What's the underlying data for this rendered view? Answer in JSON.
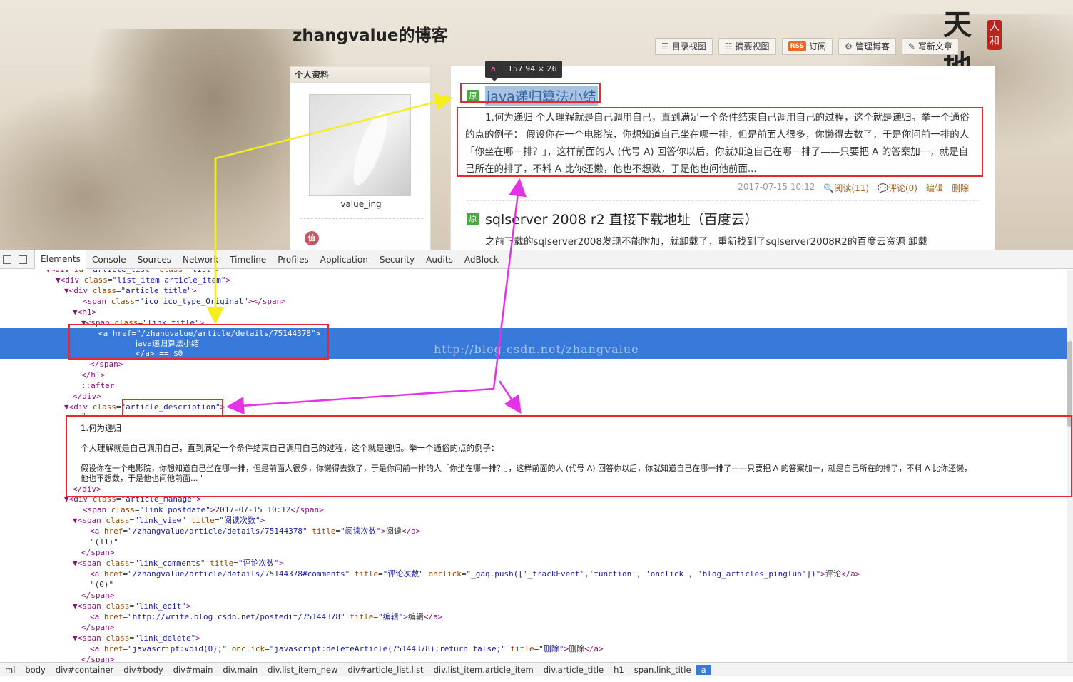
{
  "blog": {
    "title": "zhangvalue的博客",
    "seal_text": "人和",
    "calligraphy": "天地",
    "toolbar": [
      {
        "icon": "list-icon",
        "glyph": "☰",
        "label": "目录视图"
      },
      {
        "icon": "summary-icon",
        "glyph": "☷",
        "label": "摘要视图"
      },
      {
        "icon": "rss-icon",
        "glyph": "RSS",
        "label": "订阅"
      },
      {
        "icon": "gear-icon",
        "glyph": "⚙",
        "label": "管理博客"
      },
      {
        "icon": "edit-icon",
        "glyph": "✎",
        "label": "写新文章"
      }
    ],
    "sidebar": {
      "heading": "个人资料",
      "username": "value_ing",
      "badge": "值"
    },
    "tooltip": {
      "tag": "a",
      "dimensions": "157.94 × 26"
    },
    "articles": [
      {
        "badge": "原",
        "title": "java递归算法小结",
        "description": "1.何为递归 个人理解就是自己调用自己，直到满足一个条件结束自己调用自己的过程，这个就是递归。举一个通俗的点的例子： 假设你在一个电影院，你想知道自己坐在哪一排，但是前面人很多，你懒得去数了，于是你问前一排的人「你坐在哪一排？」，这样前面的人 (代号 A) 回答你以后，你就知道自己在哪一排了——只要把 A 的答案加一，就是自己所在的排了，不料 A 比你还懒，他也不想数，于是他也问他前面...",
        "date": "2017-07-15 10:12",
        "views": "阅读(11)",
        "comments": "评论(0)",
        "edit": "编辑",
        "delete": "删除"
      },
      {
        "badge": "原",
        "title": "sqlserver 2008 r2 直接下载地址（百度云）",
        "description": "之前下载的sqlserver2008发现不能附加，就卸载了，重新找到了sqlserver2008R2的百度云资源 卸载"
      }
    ]
  },
  "devtools": {
    "tabs": [
      "Elements",
      "Console",
      "Sources",
      "Network",
      "Timeline",
      "Profiles",
      "Application",
      "Security",
      "Audits",
      "AdBlock"
    ],
    "active_tab": "Elements",
    "watermark": "http://blog.csdn.net/zhangvalue",
    "desc_lines": [
      "1.何为递归",
      "个人理解就是自己调用自己，直到满足一个条件结束自己调用自己的过程，这个就是递归。举一个通俗的点的例子：",
      "假设你在一个电影院，你想知道自己坐在哪一排，但是前面人很多，你懒得去数了，于是你问前一排的人「你坐在哪一排？」，这样前面的人 (代号 A) 回答你以后，你就知道自己在哪一排了——只要把 A 的答案加一，就是自己所在的排了，不料 A 比你还懒，",
      "他也不想数，于是他也问他前面...        \""
    ],
    "breadcrumbs": [
      "ml",
      "body",
      "div#container",
      "div#body",
      "div#main",
      "div.main",
      "div.list_item_new",
      "div#article_list.list",
      "div.list_item.article_item",
      "div.article_title",
      "h1",
      "span.link_title",
      "a"
    ]
  }
}
